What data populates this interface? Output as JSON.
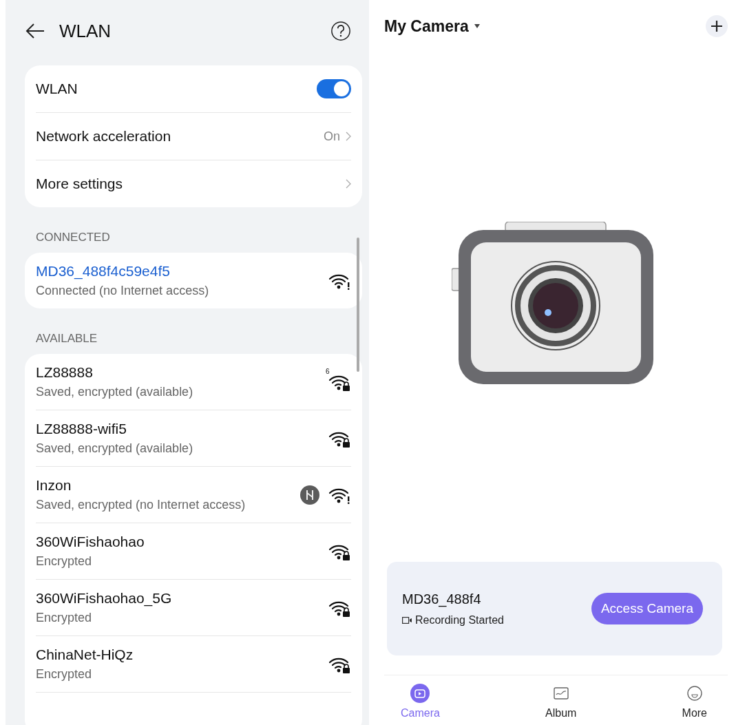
{
  "settings": {
    "title": "WLAN",
    "toggles": [
      {
        "kind": "switch",
        "label": "WLAN",
        "on": true
      },
      {
        "kind": "link",
        "label": "Network acceleration",
        "value": "On"
      },
      {
        "kind": "link",
        "label": "More settings"
      }
    ],
    "connected_header": "CONNECTED",
    "connected": {
      "name": "MD36_488f4c59e4f5",
      "status": "Connected (no Internet access)",
      "kind": "alert"
    },
    "available_header": "AVAILABLE",
    "available": [
      {
        "name": "LZ88888",
        "status": "Saved, encrypted (available)",
        "kind": "lock",
        "badge": "6",
        "shared": false
      },
      {
        "name": "LZ88888-wifi5",
        "status": "Saved, encrypted (available)",
        "kind": "lock",
        "shared": false
      },
      {
        "name": "Inzon",
        "status": "Saved, encrypted (no Internet access)",
        "kind": "alert",
        "shared": true
      },
      {
        "name": "360WiFishaohao",
        "status": "Encrypted",
        "kind": "lock",
        "shared": false
      },
      {
        "name": "360WiFishaohao_5G",
        "status": "Encrypted",
        "kind": "lock",
        "shared": false
      },
      {
        "name": "ChinaNet-HiQz",
        "status": "Encrypted",
        "kind": "lock",
        "shared": false
      }
    ]
  },
  "camera_app": {
    "title": "My Camera",
    "device": {
      "name": "MD36_488f4",
      "status": "Recording Started",
      "button": "Access Camera"
    },
    "nav": [
      {
        "label": "Camera",
        "selected": true
      },
      {
        "label": "Album",
        "selected": false
      },
      {
        "label": "More",
        "selected": false
      }
    ]
  }
}
